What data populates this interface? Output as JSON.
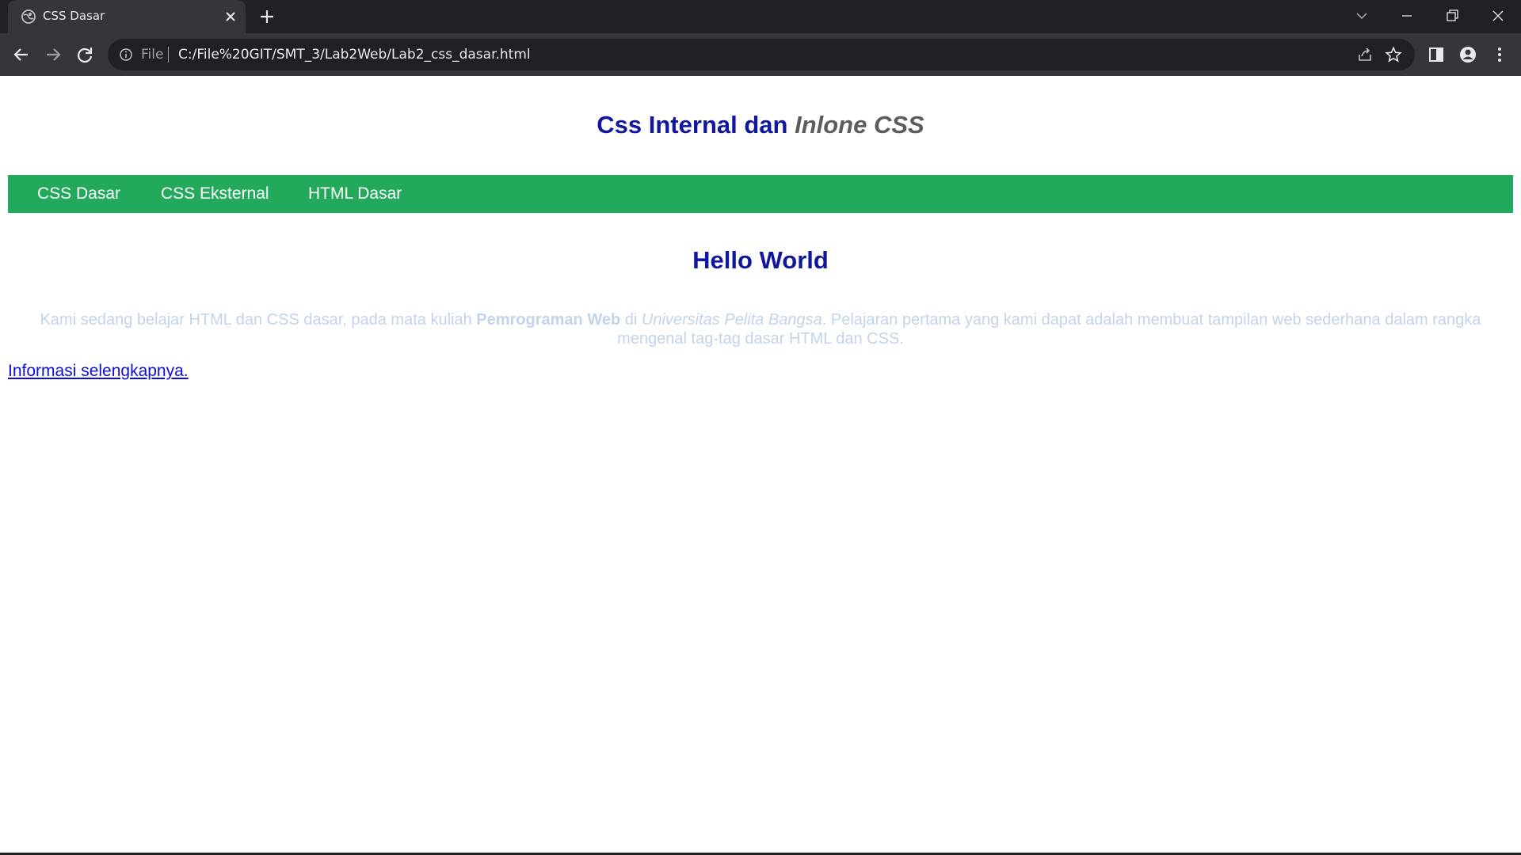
{
  "browser": {
    "tab_title": "CSS Dasar",
    "omnibox": {
      "scheme_label": "File",
      "url": "C:/File%20GIT/SMT_3/Lab2Web/Lab2_css_dasar.html"
    },
    "colors": {
      "frame": "#202124",
      "toolbar": "#35363a",
      "text": "#e8eaed"
    }
  },
  "page": {
    "header": {
      "title_main": "Css Internal dan ",
      "title_em": "Inlone CSS"
    },
    "nav": {
      "items": [
        {
          "label": "CSS Dasar"
        },
        {
          "label": "CSS Eksternal"
        },
        {
          "label": "HTML Dasar"
        }
      ]
    },
    "content": {
      "heading": "Hello World",
      "paragraph": {
        "part1": "Kami sedang belajar HTML dan CSS dasar, pada mata kuliah ",
        "bold": "Pemrograman Web",
        "part2": " di ",
        "italic": "Universitas Pelita Bangsa",
        "part3": ". Pelajaran pertama yang kami dapat adalah membuat tampilan web sederhana dalam rangka mengenal tag-tag dasar HTML dan CSS."
      },
      "link": "Informasi selengkapnya."
    },
    "colors": {
      "heading": "#10179a",
      "nav_bg": "#22a95b",
      "paragraph": "#c2d4ea",
      "link": "#0e0edb"
    }
  }
}
